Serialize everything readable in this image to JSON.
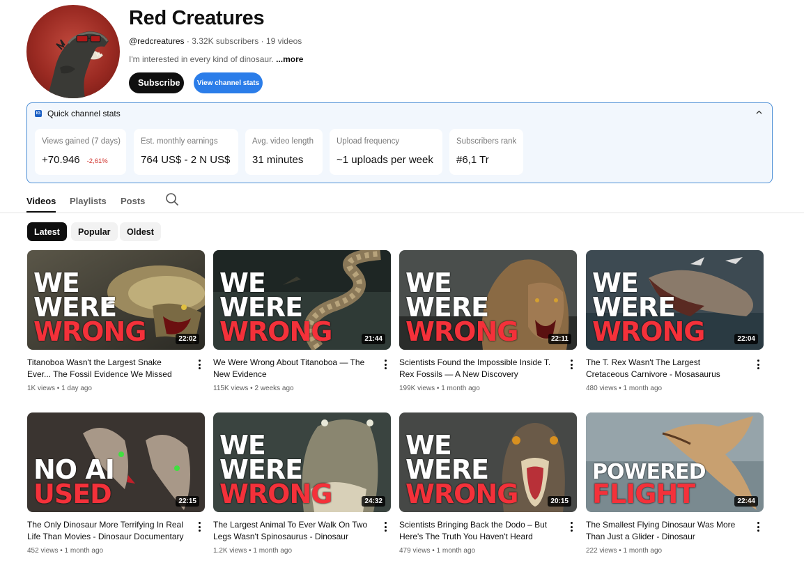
{
  "channel": {
    "name": "Red Creatures",
    "handle": "@redcreatures",
    "stats_line": " · 3.32K subscribers · 19 videos",
    "description": "I'm interested in every kind of dinosaur. ",
    "more_label": "...more",
    "subscribe_label": "Subscribe",
    "view_stats_label": "View channel stats"
  },
  "quick_stats": {
    "title": "Quick channel stats",
    "logo_text": "IG",
    "cards": [
      {
        "label": "Views gained (7 days)",
        "value": "+70.946",
        "change": "-2,61%"
      },
      {
        "label": "Est. monthly earnings",
        "value": "764 US$ - 2 N US$"
      },
      {
        "label": "Avg. video length",
        "value": "31 minutes"
      },
      {
        "label": "Upload frequency",
        "value": "~1 uploads per week"
      },
      {
        "label": "Subscribers rank",
        "value": "#6,1 Tr"
      }
    ]
  },
  "tabs": [
    "Videos",
    "Playlists",
    "Posts"
  ],
  "chips": [
    "Latest",
    "Popular",
    "Oldest"
  ],
  "colors": {
    "accent": "#2b7de9",
    "thumb_red": "#f4313a",
    "panel_border": "#4d8fd6"
  },
  "videos": [
    {
      "title": "Titanoboa Wasn't the Largest Snake Ever... The Fossil Evidence We Missed",
      "meta": "1K views • 1 day ago",
      "duration": "22:02",
      "thumb_white": [
        "WE",
        "WERE"
      ],
      "thumb_red": [
        "WRONG"
      ]
    },
    {
      "title": "We Were Wrong About Titanoboa — The New Evidence",
      "meta": "115K views • 2 weeks ago",
      "duration": "21:44",
      "thumb_white": [
        "WE",
        "WERE"
      ],
      "thumb_red": [
        "WRONG"
      ]
    },
    {
      "title": "Scientists Found the Impossible Inside T. Rex Fossils — A New Discovery",
      "meta": "199K views • 1 month ago",
      "duration": "22:11",
      "thumb_white": [
        "WE",
        "WERE"
      ],
      "thumb_red": [
        "WRONG"
      ]
    },
    {
      "title": "The T. Rex Wasn't The Largest Cretaceous Carnivore - Mosasaurus Documentary",
      "meta": "480 views • 1 month ago",
      "duration": "22:04",
      "thumb_white": [
        "WE",
        "WERE"
      ],
      "thumb_red": [
        "WRONG"
      ]
    },
    {
      "title": "The Only Dinosaur More Terrifying In Real Life Than Movies - Dinosaur Documentary",
      "meta": "452 views • 1 month ago",
      "duration": "22:15",
      "thumb_white": [
        "NO AI"
      ],
      "thumb_red": [
        "USED"
      ]
    },
    {
      "title": "The Largest Animal To Ever Walk On Two Legs Wasn't Spinosaurus - Dinosaur Documentary",
      "meta": "1.2K views • 1 month ago",
      "duration": "24:32",
      "thumb_white": [
        "WE",
        "WERE"
      ],
      "thumb_red": [
        "WRONG"
      ]
    },
    {
      "title": "Scientists Bringing Back the Dodo – But Here's The Truth You Haven't Heard",
      "meta": "479 views • 1 month ago",
      "duration": "20:15",
      "thumb_white": [
        "WE",
        "WERE"
      ],
      "thumb_red": [
        "WRONG"
      ]
    },
    {
      "title": "The Smallest Flying Dinosaur Was More Than Just a Glider - Dinosaur Documentary",
      "meta": "222 views • 1 month ago",
      "duration": "22:44",
      "thumb_white": [
        "POWERED"
      ],
      "thumb_red": [
        "FLIGHT"
      ]
    }
  ]
}
